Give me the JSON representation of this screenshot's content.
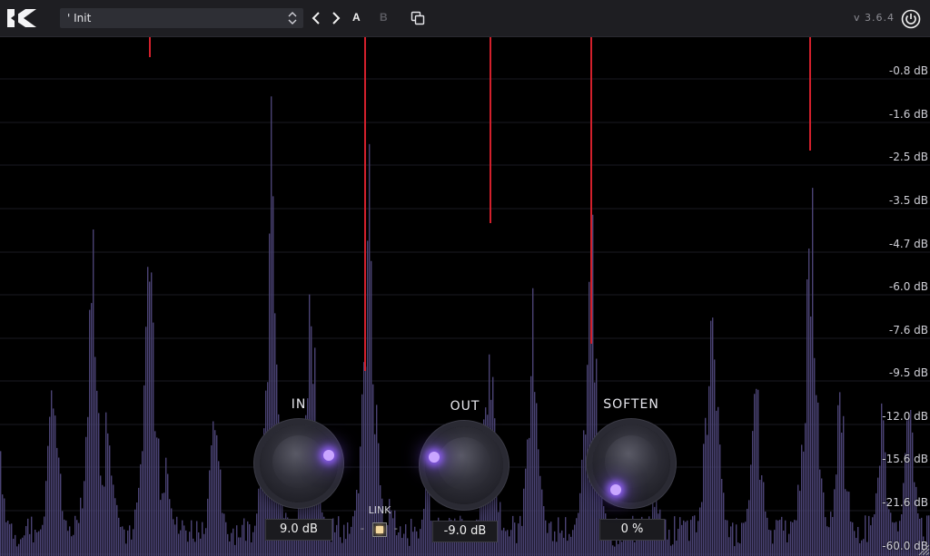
{
  "header": {
    "preset_name": "' Init",
    "prev_label": "‹",
    "next_label": "›",
    "a_label": "A",
    "b_label": "B",
    "version": "v 3.6.4",
    "icons": {
      "logo": "k-logo-icon",
      "preset_arrows": "updown-arrows-icon",
      "copy": "copy-icon",
      "power": "power-icon"
    }
  },
  "meter": {
    "db_scale": [
      "-0.8 dB",
      "-1.6 dB",
      "-2.5 dB",
      "-3.5 dB",
      "-4.7 dB",
      "-6.0 dB",
      "-7.6 dB",
      "-9.5 dB",
      "-12.0 dB",
      "-15.6 dB",
      "-21.6 dB",
      "-60.0 dB"
    ]
  },
  "controls": {
    "in": {
      "label": "IN",
      "value": "9.0 dB",
      "position": 0.75
    },
    "out": {
      "label": "OUT",
      "value": "-9.0 dB",
      "position": 0.25
    },
    "soften": {
      "label": "SOFTEN",
      "value": "0 %",
      "position": 0.0
    },
    "link": {
      "label": "LINK",
      "left_dash": "-",
      "right_dash": "-",
      "checked": true
    }
  },
  "colors": {
    "bar": "#4a4374",
    "clip": "#d3202c",
    "glow": "#a27cff",
    "link_on": "#f5d9a0"
  }
}
